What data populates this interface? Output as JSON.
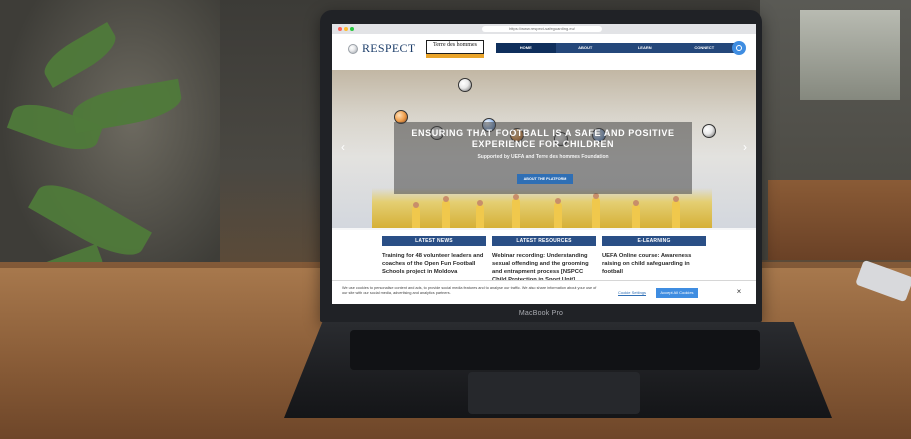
{
  "browser": {
    "url": "https://www.respect-safeguarding.eu/"
  },
  "site": {
    "brand_name": "RESPECT",
    "partner_logo_text": "Terre des hommes",
    "nav": [
      {
        "label": "HOME"
      },
      {
        "label": "ABOUT"
      },
      {
        "label": "LEARN"
      },
      {
        "label": "CONNECT"
      }
    ],
    "search_icon": "search-icon"
  },
  "hero": {
    "title": "ENSURING THAT FOOTBALL IS A SAFE AND POSITIVE EXPERIENCE FOR CHILDREN",
    "subtitle": "Supported by UEFA and Terre des hommes Foundation",
    "cta_label": "ABOUT THE PLATFORM",
    "left_arrow_icon": "chevron-left-icon",
    "right_arrow_icon": "chevron-right-icon"
  },
  "sections": [
    {
      "heading": "LATEST NEWS",
      "title": "Training for 48 volunteer leaders and coaches of the Open Fun Football Schools project in Moldova"
    },
    {
      "heading": "LATEST RESOURCES",
      "title": "Webinar recording: Understanding sexual offending and the grooming and entrapment process [NSPCC Child Protection in Sport Unit]"
    },
    {
      "heading": "E-LEARNING",
      "title": "UEFA Online course: Awareness raising on child safeguarding in football"
    }
  ],
  "cookie_banner": {
    "text": "We use cookies to personalise content and ads, to provide social media features and to analyse our traffic. We also share information about your use of our site with our social media, advertising and analytics partners.",
    "settings_label": "Cookie Settings",
    "accept_label": "Accept All Cookies",
    "close_icon": "close-icon"
  },
  "device_label": "MacBook Pro",
  "colors": {
    "nav": "#24477a",
    "accent": "#3f8de1",
    "section_head": "#2a4f86"
  }
}
